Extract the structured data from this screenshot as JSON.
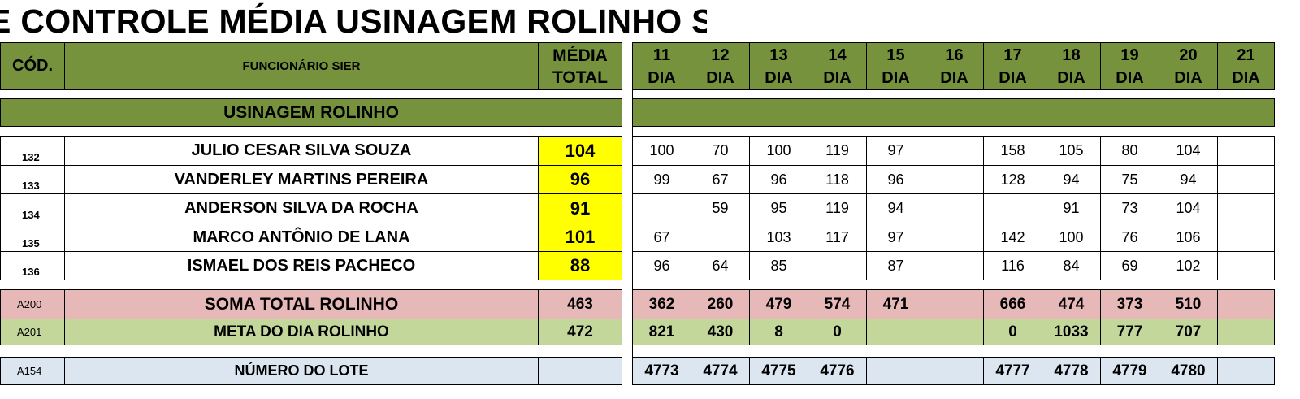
{
  "title": "E CONTROLE MÉDIA USINAGEM ROLINHO  S",
  "header": {
    "cod": "CÓD.",
    "funcionario": "FUNCIONÁRIO SIER",
    "media_l1": "MÉDIA",
    "media_l2": "TOTAL",
    "day_word": "DIA",
    "days": [
      "11",
      "12",
      "13",
      "14",
      "15",
      "16",
      "17",
      "18",
      "19",
      "20",
      "21"
    ]
  },
  "section": {
    "label": "USINAGEM ROLINHO"
  },
  "employees": [
    {
      "code": "132",
      "name": "JULIO CESAR SILVA SOUZA",
      "avg": "104",
      "values": [
        "100",
        "70",
        "100",
        "119",
        "97",
        "",
        "158",
        "105",
        "80",
        "104",
        ""
      ]
    },
    {
      "code": "133",
      "name": "VANDERLEY MARTINS PEREIRA",
      "avg": "96",
      "values": [
        "99",
        "67",
        "96",
        "118",
        "96",
        "",
        "128",
        "94",
        "75",
        "94",
        ""
      ]
    },
    {
      "code": "134",
      "name": "ANDERSON SILVA DA ROCHA",
      "avg": "91",
      "values": [
        "",
        "59",
        "95",
        "119",
        "94",
        "",
        "",
        "91",
        "73",
        "104",
        ""
      ]
    },
    {
      "code": "135",
      "name": "MARCO ANTÔNIO DE LANA",
      "avg": "101",
      "values": [
        "67",
        "",
        "103",
        "117",
        "97",
        "",
        "142",
        "100",
        "76",
        "106",
        ""
      ]
    },
    {
      "code": "136",
      "name": "ISMAEL DOS REIS PACHECO",
      "avg": "88",
      "values": [
        "96",
        "64",
        "85",
        "",
        "87",
        "",
        "116",
        "84",
        "69",
        "102",
        ""
      ]
    }
  ],
  "soma": {
    "code": "A200",
    "label": "SOMA TOTAL ROLINHO",
    "total": "463",
    "values": [
      "362",
      "260",
      "479",
      "574",
      "471",
      "",
      "666",
      "474",
      "373",
      "510",
      ""
    ]
  },
  "meta": {
    "code": "A201",
    "label": "META DO DIA ROLINHO",
    "total": "472",
    "values": [
      "821",
      "430",
      "8",
      "0",
      "",
      "",
      "0",
      "1033",
      "777",
      "707",
      ""
    ]
  },
  "lote": {
    "code": "A154",
    "label": "NÚMERO DO LOTE",
    "total": "",
    "values": [
      "4773",
      "4774",
      "4775",
      "4776",
      "",
      "",
      "4777",
      "4778",
      "4779",
      "4780",
      ""
    ]
  },
  "colors": {
    "header_green": "#76923c",
    "average_yellow": "#ffff00",
    "soma_pink": "#e6b8b7",
    "meta_green": "#c4d79b",
    "lote_blue": "#dce6f1"
  }
}
